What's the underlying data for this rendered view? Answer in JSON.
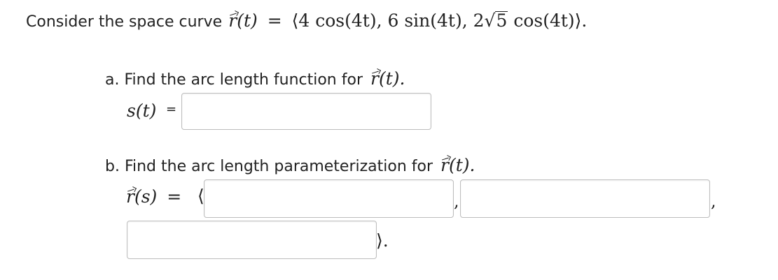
{
  "prompt": {
    "lead": "Consider the space curve",
    "r_symbol": "r",
    "t_arg": "(t)",
    "equals": "=",
    "open": "⟨",
    "c1": "4 cos(4t), 6 sin(4t), 2",
    "root": "5",
    "c3": "cos(4t)",
    "close": "⟩."
  },
  "part_a": {
    "label": "a. Find the arc length function for",
    "r_symbol": "r",
    "arg": "(t).",
    "lhs": "s(t)",
    "eq": "=",
    "answer": {
      "value": "",
      "placeholder": ""
    }
  },
  "part_b": {
    "label": "b. Find the arc length parameterization for",
    "r_symbol": "r",
    "arg": "(t).",
    "lhs_symbol": "r",
    "lhs_arg": "(s)",
    "eq": "=",
    "open": "⟨",
    "comma": ",",
    "close": "⟩.",
    "answers": [
      {
        "value": "",
        "placeholder": ""
      },
      {
        "value": "",
        "placeholder": ""
      },
      {
        "value": "",
        "placeholder": ""
      }
    ]
  }
}
